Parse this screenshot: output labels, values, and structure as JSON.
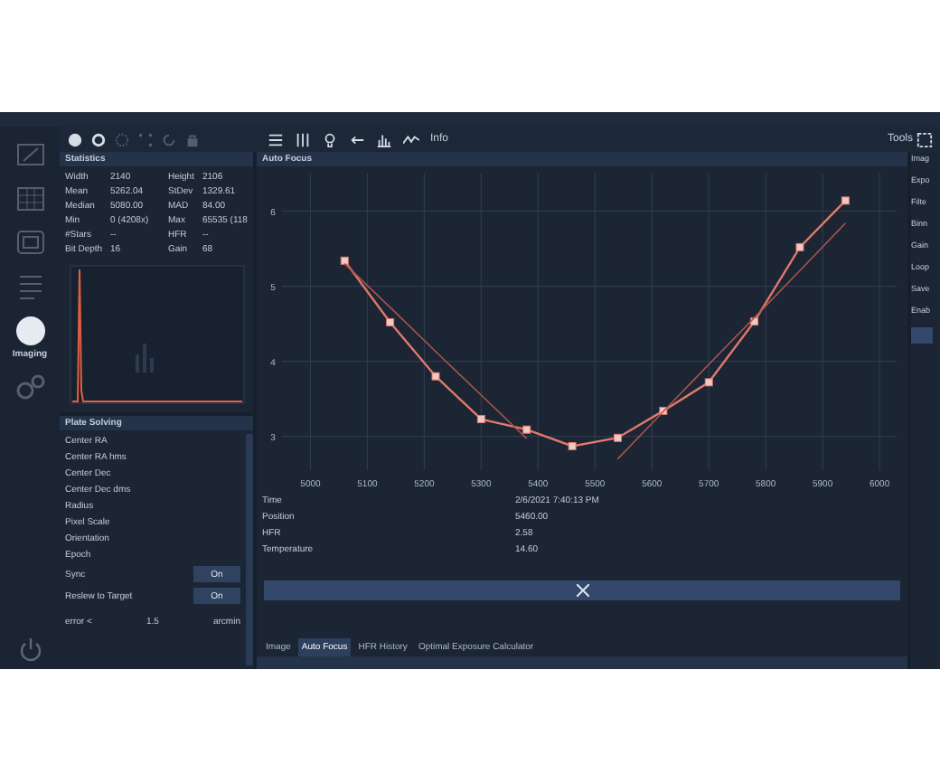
{
  "sidebar": {
    "items": [
      {
        "kind": "monitor",
        "selected": false
      },
      {
        "kind": "grid",
        "selected": false
      },
      {
        "kind": "frame",
        "selected": false
      },
      {
        "kind": "list",
        "selected": false
      },
      {
        "kind": "circle",
        "label": "Imaging",
        "selected": true
      },
      {
        "kind": "gears",
        "selected": false
      }
    ]
  },
  "toolbar": {
    "left_icons": [
      {
        "kind": "disc",
        "selected": true
      },
      {
        "kind": "ring",
        "selected": true
      },
      {
        "kind": "burst",
        "selected": false
      },
      {
        "kind": "dots",
        "selected": false
      },
      {
        "kind": "refresh",
        "selected": false
      },
      {
        "kind": "lock",
        "selected": false
      }
    ],
    "center_icons": [
      {
        "kind": "lines"
      },
      {
        "kind": "columns"
      },
      {
        "kind": "bulb"
      },
      {
        "kind": "arrow"
      },
      {
        "kind": "bars"
      }
    ],
    "info_label": "Info",
    "tools_label": "Tools"
  },
  "statistics": {
    "title": "Statistics",
    "rows": [
      [
        "Width",
        "2140",
        "Height",
        "2106"
      ],
      [
        "Mean",
        "5262.04",
        "StDev",
        "1329.61"
      ],
      [
        "Median",
        "5080.00",
        "MAD",
        "84.00"
      ],
      [
        "Min",
        "0 (4208x)",
        "Max",
        "65535 (118"
      ],
      [
        "#Stars",
        "--",
        "HFR",
        "--"
      ],
      [
        "Bit Depth",
        "16",
        "Gain",
        "68"
      ]
    ]
  },
  "plate_solving": {
    "title": "Plate Solving",
    "fields": [
      "Center RA",
      "Center RA hms",
      "Center Dec",
      "Center Dec dms",
      "Radius",
      "Pixel Scale",
      "Orientation",
      "Epoch"
    ],
    "toggles": [
      {
        "label": "Sync",
        "value": "On"
      },
      {
        "label": "Reslew to Target",
        "value": "On"
      }
    ],
    "error": {
      "label": "error <",
      "value": "1.5",
      "unit": "arcmin"
    }
  },
  "auto_focus": {
    "title": "Auto Focus",
    "chart_data": {
      "type": "line",
      "x": [
        5060,
        5140,
        5220,
        5300,
        5380,
        5460,
        5540,
        5620,
        5700,
        5780,
        5860,
        5940
      ],
      "series": [
        {
          "color": "#e0796c",
          "marker": "square",
          "values": [
            5.34,
            4.52,
            3.8,
            3.23,
            3.09,
            2.87,
            2.98,
            3.34,
            3.72,
            4.53,
            5.52,
            6.14
          ]
        },
        {
          "color": "#a9554c",
          "values": [
            5.3,
            4.72,
            4.13,
            3.55,
            2.97,
            null,
            null,
            null,
            null,
            null,
            null,
            null
          ]
        },
        {
          "color": "#a9554c",
          "values": [
            null,
            null,
            null,
            null,
            null,
            null,
            2.7,
            3.33,
            3.96,
            4.58,
            5.21,
            5.84
          ]
        }
      ],
      "grid": true,
      "xlim": [
        4950,
        6030
      ],
      "ylim": [
        2.55,
        6.5
      ],
      "xticks": [
        5000,
        5100,
        5200,
        5300,
        5400,
        5500,
        5600,
        5700,
        5800,
        5900,
        6000
      ],
      "yticks": [
        3,
        4,
        5,
        6
      ]
    },
    "info": [
      {
        "label": "Time",
        "value": "2/6/2021 7:40:13 PM"
      },
      {
        "label": "Position",
        "value": "5460.00"
      },
      {
        "label": "HFR",
        "value": "2.58"
      },
      {
        "label": "Temperature",
        "value": "14.60"
      }
    ]
  },
  "tabs": [
    {
      "label": "Image",
      "selected": false
    },
    {
      "label": "Auto Focus",
      "selected": true
    },
    {
      "label": "HFR History",
      "selected": false
    },
    {
      "label": "Optimal Exposure Calculator",
      "selected": false
    }
  ],
  "right_panel": {
    "title": "Imag",
    "items": [
      "Expo",
      "Filte",
      "Binn",
      "Gain",
      "Loop",
      "Save",
      "Enab"
    ]
  }
}
